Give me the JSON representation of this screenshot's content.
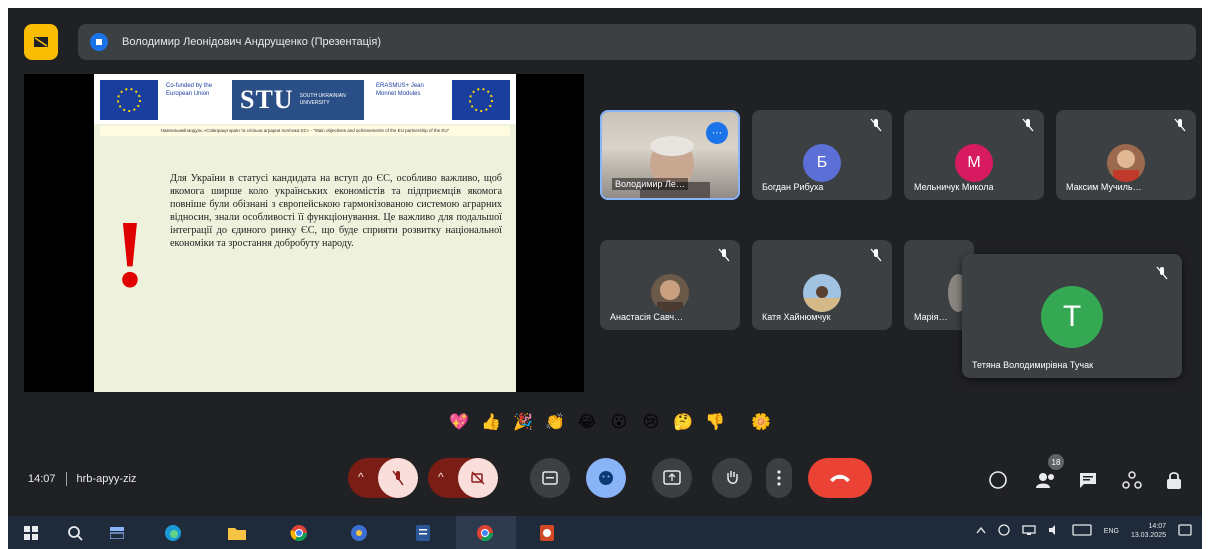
{
  "header": {
    "presenter_text": "Володимир Леонідович Андрущенко (Презентація)"
  },
  "slide": {
    "eu_cofunded": "Co-funded by the European Union",
    "university_logo": "STU",
    "university_sub": "SOUTH UKRAINIAN UNIVERSITY",
    "jean_monnet": "ERASMUS+ Jean Monnet Modules",
    "caption": "Навчальний модуль «Співпраця країн та спільна аграрна політика ЄС» · \"Main objectives and achievements of the EU partnership of the EU\"",
    "exclamation": "!",
    "body": "Для України в статусі кандидата на вступ до ЄС, особливо важливо, щоб якомога ширше коло українських економістів та підприємців якомога повніше були обізнані з європейською гармонізованою системою аграрних відносин, знали особливості її функціонування. Це важливо для подальшої інтеграції до єдиного ринку ЄС, що буде сприяти розвитку національної економіки та зростання добробуту народу."
  },
  "participants": [
    {
      "name": "Володимир Ле…",
      "type": "video"
    },
    {
      "name": "Богдан Рибуха",
      "initial": "Б",
      "color": "#5b6fd6"
    },
    {
      "name": "Мельничук Микола",
      "initial": "М",
      "color": "#d81b60"
    },
    {
      "name": "Максим Мучиль…",
      "type": "photo"
    },
    {
      "name": "Анастасія Савч…",
      "type": "photo"
    },
    {
      "name": "Катя Хайнюмчук",
      "type": "photo"
    },
    {
      "name": "Марія…",
      "type": "photo"
    }
  ],
  "floating_tile": {
    "initial": "Т",
    "name": "Тетяна Володимирівна Тучак"
  },
  "reactions": [
    "💖",
    "👍",
    "🎉",
    "👏",
    "😂",
    "😮",
    "😢",
    "🤔",
    "👎",
    "🌼"
  ],
  "controls": {
    "time": "14:07",
    "meeting_code": "hrb-apyy-ziz"
  },
  "people_count": "18",
  "tray": {
    "lang": "ENG",
    "time": "14:07",
    "date": "13.03.2025"
  }
}
